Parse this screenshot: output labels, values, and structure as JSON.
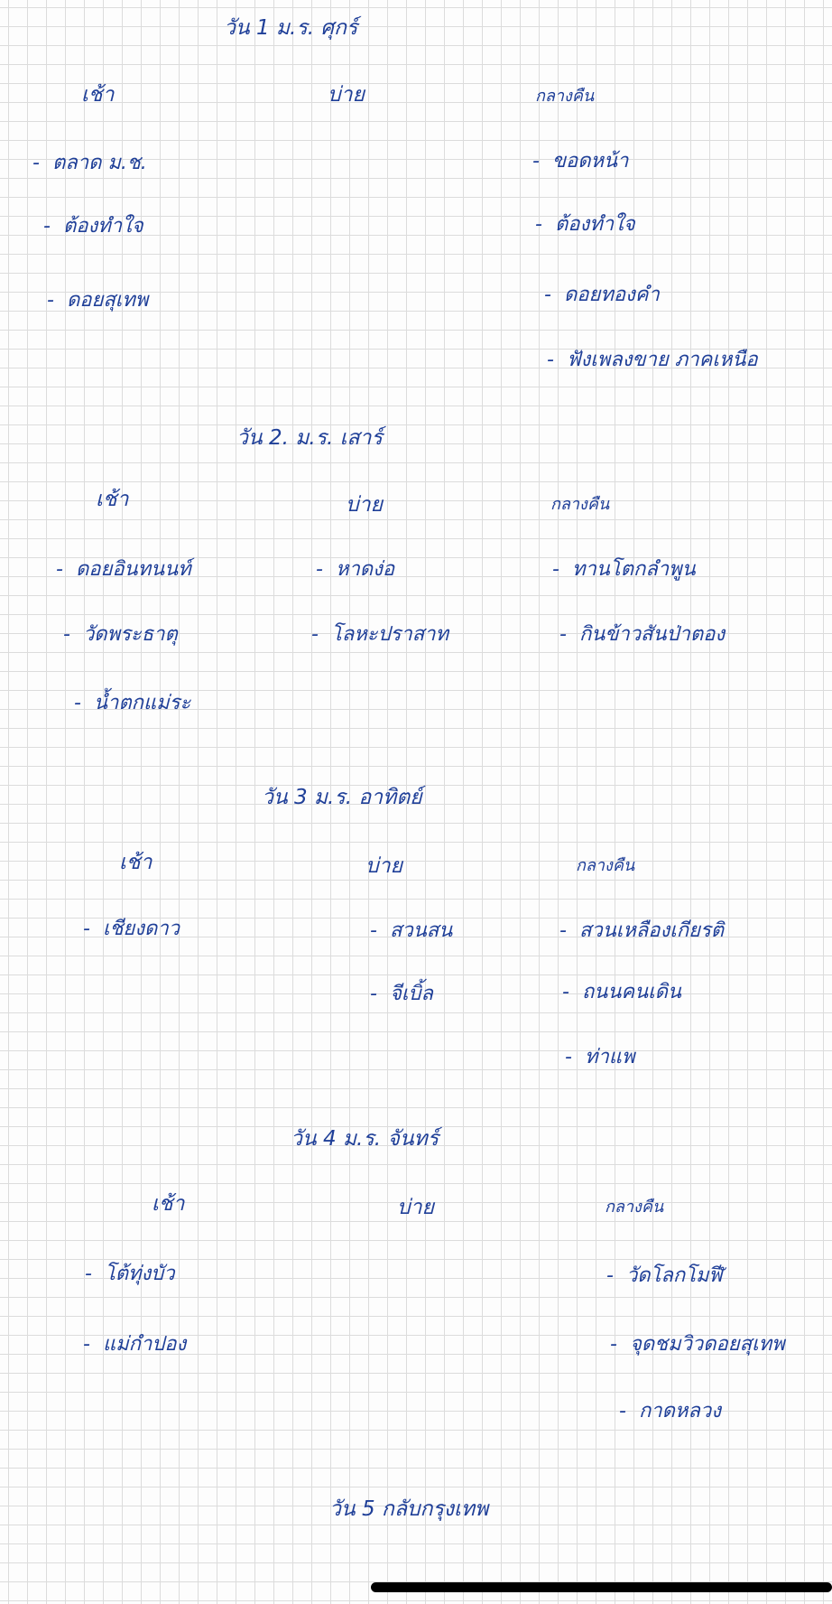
{
  "colors": {
    "ink": "#1f3f98",
    "grid": "#dcdcdc",
    "paper": "#fdfdfd"
  },
  "days": [
    {
      "title": "วัน 1  ม.ร. ศุกร์",
      "headers": {
        "morning": "เช้า",
        "afternoon": "บ่าย",
        "evening": "กลางคืน"
      },
      "morning": [
        "ตลาด ม.ช.",
        "ต้องทำใจ",
        "ดอยสุเทพ"
      ],
      "afternoon": [],
      "evening": [
        "ขอดหน้า",
        "ต้องทำใจ",
        "ดอยทองคำ",
        "ฟังเพลงขาย ภาคเหนือ"
      ]
    },
    {
      "title": "วัน 2.  ม.ร. เสาร์",
      "headers": {
        "morning": "เช้า",
        "afternoon": "บ่าย",
        "evening": "กลางคืน"
      },
      "morning": [
        "ดอยอินทนนท์",
        "วัดพระธาตุ",
        "น้ำตกแม่ระ"
      ],
      "afternoon": [
        "หาดง่อ",
        "โลหะปราสาท"
      ],
      "evening": [
        "ทานโตกลำพูน",
        "กินข้าวสันป่าตอง"
      ]
    },
    {
      "title": "วัน 3  ม.ร. อาทิตย์",
      "headers": {
        "morning": "เช้า",
        "afternoon": "บ่าย",
        "evening": "กลางคืน"
      },
      "morning": [
        "เชียงดาว"
      ],
      "afternoon": [
        "สวนสน",
        "จีเบิ้ล"
      ],
      "evening": [
        "สวนเหลืองเกียรติ",
        "ถนนคนเดิน",
        "ท่าแพ"
      ]
    },
    {
      "title": "วัน 4  ม.ร. จันทร์",
      "headers": {
        "morning": "เช้า",
        "afternoon": "บ่าย",
        "evening": "กลางคืน"
      },
      "morning": [
        "โต้ทุ่งบัว",
        "แม่กำปอง"
      ],
      "afternoon": [],
      "evening": [
        "วัดโลกโมฬี",
        "จุดชมวิวดอยสุเทพ",
        "กาดหลวง"
      ]
    }
  ],
  "footer": {
    "title": "วัน 5 กลับกรุงเทพ"
  }
}
